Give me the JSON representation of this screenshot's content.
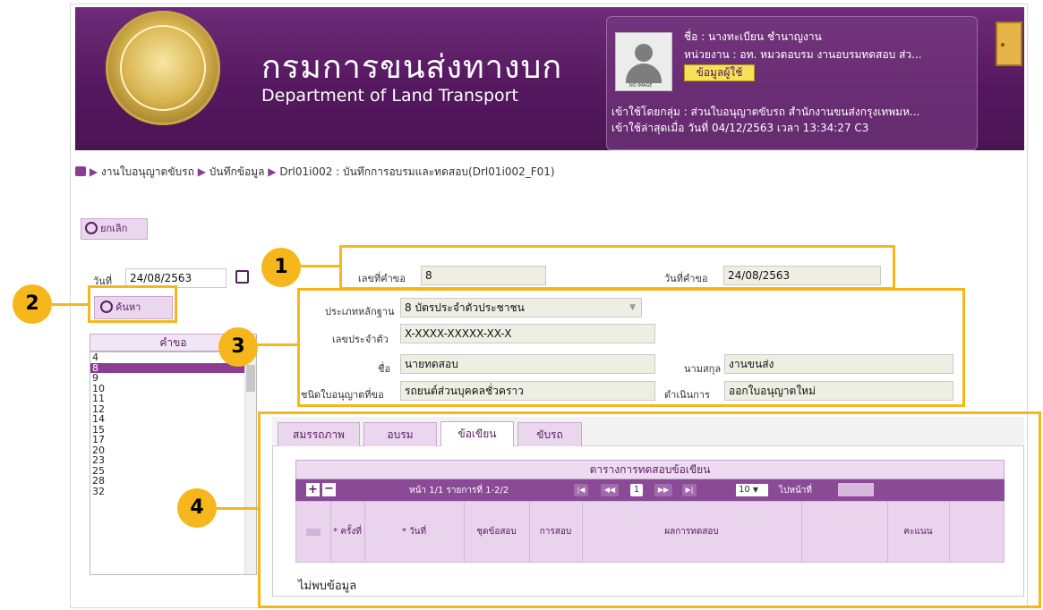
{
  "header": {
    "title_th": "กรมการขนส่งทางบก",
    "title_en": "Department of Land Transport",
    "avatar_caption": "NO IMAGE",
    "user_name": "ชื่อ :  นางทะเบียน ชำนาญงาน",
    "user_unit": "หน่วยงาน : อท. หมวดอบรม งานอบรมทดสอบ ส่ว...",
    "user_button": "ข้อมูลผู้ใช้",
    "login_group": "เข้าใช้โดยกลุ่ม : ส่วนใบอนุญาตขับรถ สำนักงานขนส่งกรุงเทพมห...",
    "last_login": "เข้าใช้ล่าสุดเมื่อ วันที่ 04/12/2563 เวลา 13:34:27 C3"
  },
  "breadcrumb": {
    "items": [
      "งานใบอนุญาตขับรถ",
      "บันทึกข้อมูล",
      "Drl01i002 : บันทึกการอบรมและทดสอบ(Drl01i002_F01)"
    ]
  },
  "cancel_label": "ยกเลิก",
  "search": {
    "date_label": "วันที่",
    "date_value": "24/08/2563",
    "button_label": "ค้นหา"
  },
  "request_list": {
    "header": "คำขอ",
    "items": [
      "4",
      "8",
      "9",
      "10",
      "11",
      "12",
      "14",
      "15",
      "17",
      "20",
      "23",
      "25",
      "28",
      "32"
    ],
    "selected": "8"
  },
  "request_info": {
    "req_no_label": "เลขที่คำขอ",
    "req_no": "8",
    "req_date_label": "วันที่คำขอ",
    "req_date": "24/08/2563"
  },
  "person": {
    "doc_type_label": "ประเภทหลักฐาน",
    "doc_type": "8 บัตรประจำตัวประชาชน",
    "id_label": "เลขประจำตัว",
    "id_value": "X-XXXX-XXXXX-XX-X",
    "fname_label": "ชื่อ",
    "fname": "นายทดสอบ",
    "lname_label": "นามสกุล",
    "lname": "งานขนส่ง",
    "license_type_label": "ชนิดใบอนุญาตที่ขอ",
    "license_type": "รถยนต์ส่วนบุคคลชั่วคราว",
    "action_label": "ดำเนินการ",
    "action": "ออกใบอนุญาตใหม่"
  },
  "tabs": [
    "สมรรถภาพ",
    "อบรม",
    "ข้อเขียน",
    "ขับรถ"
  ],
  "active_tab": "ข้อเขียน",
  "grid": {
    "title": "ตารางการทดสอบข้อเขียน",
    "page_info": "หน้า 1/1 รายการที่ 1-2/2",
    "page_number": "1",
    "page_size": "10",
    "goto_label": "ไปหน้าที่",
    "columns": [
      "* ครั้งที่",
      "* วันที่",
      "ชุดข้อสอบ",
      "การสอบ",
      "ผลการทดสอบ",
      "",
      "คะแนน"
    ],
    "empty_text": "ไม่พบข้อมูล"
  },
  "callouts": [
    "1",
    "2",
    "3",
    "4"
  ],
  "colors": {
    "brand_purple": "#55185f",
    "callout": "#f6b71c",
    "tab": "#ead7ee"
  }
}
